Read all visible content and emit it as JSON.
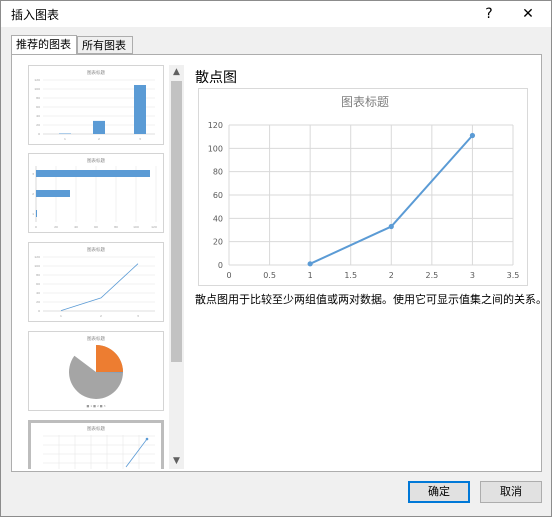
{
  "window": {
    "title": "插入图表",
    "help_label": "?",
    "close_label": "✕"
  },
  "tabs": [
    {
      "label": "推荐的图表",
      "active": true
    },
    {
      "label": "所有图表",
      "active": false
    }
  ],
  "scrollbar": {
    "up": "▲",
    "down": "▼"
  },
  "thumbnails": {
    "title": "图表标题",
    "items": [
      {
        "type": "bar-vertical",
        "values": [
          1,
          33,
          111
        ],
        "categories": [
          "1",
          "2",
          "3"
        ],
        "y_ticks": [
          "120",
          "100",
          "80",
          "60",
          "40",
          "20",
          "0"
        ]
      },
      {
        "type": "bar-horizontal",
        "values": [
          111,
          33,
          1
        ],
        "categories": [
          "3",
          "2",
          "1"
        ],
        "x_ticks": [
          "0",
          "20",
          "40",
          "60",
          "80",
          "100",
          "120"
        ]
      },
      {
        "type": "line",
        "values": [
          1,
          33,
          111
        ],
        "categories": [
          "1",
          "2",
          "3"
        ],
        "y_ticks": [
          "120",
          "100",
          "80",
          "60",
          "40",
          "20",
          "0"
        ]
      },
      {
        "type": "pie",
        "legend": "■ 1  ■ 2  ■ 3"
      },
      {
        "type": "scatter",
        "selected": true
      }
    ]
  },
  "preview": {
    "chart_type_label": "散点图",
    "description": "散点图用于比较至少两组值或两对数据。使用它可显示值集之间的关系。"
  },
  "chart_data": {
    "type": "scatter",
    "title": "图表标题",
    "x": [
      1,
      2,
      3
    ],
    "y": [
      1,
      33,
      111
    ],
    "xlim": [
      0,
      3.5
    ],
    "ylim": [
      0,
      120
    ],
    "x_ticks": [
      "0",
      "0.5",
      "1",
      "1.5",
      "2",
      "2.5",
      "3",
      "3.5"
    ],
    "y_ticks": [
      "0",
      "20",
      "40",
      "60",
      "80",
      "100",
      "120"
    ],
    "line_color": "#5b9bd5",
    "grid": true
  },
  "buttons": {
    "ok": "确定",
    "cancel": "取消"
  }
}
